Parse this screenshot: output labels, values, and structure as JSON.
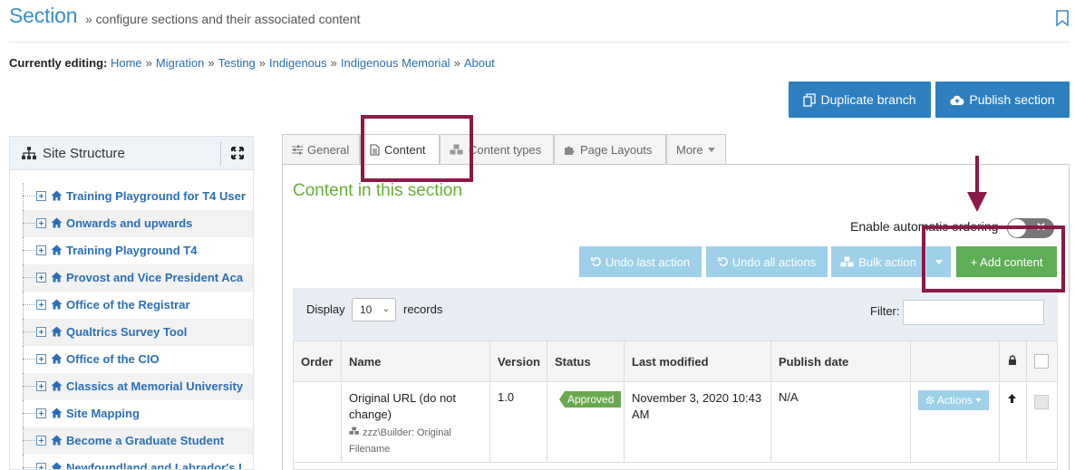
{
  "header": {
    "title": "Section",
    "subtitle": "» configure sections and their associated content"
  },
  "breadcrumb": {
    "label": "Currently editing:",
    "items": [
      "Home",
      "Migration",
      "Testing",
      "Indigenous",
      "Indigenous Memorial",
      "About"
    ],
    "separator": "»"
  },
  "actions": {
    "duplicate": "Duplicate branch",
    "publish": "Publish section"
  },
  "site_structure": {
    "title": "Site Structure",
    "items": [
      "Training Playground for T4 User",
      "Onwards and upwards",
      "Training Playground T4",
      "Provost and Vice President Aca",
      "Office of the Registrar",
      "Qualtrics Survey Tool",
      "Office of the CIO",
      "Classics at Memorial University",
      "Site Mapping",
      "Become a Graduate Student",
      "Newfoundland and Labrador's I"
    ]
  },
  "tabs": [
    {
      "label": "General",
      "icon": "sliders-icon",
      "active": false
    },
    {
      "label": "Content",
      "icon": "document-icon",
      "active": true
    },
    {
      "label": "Content types",
      "icon": "cubes-icon",
      "active": false
    },
    {
      "label": "Page Layouts",
      "icon": "puzzle-icon",
      "active": false
    },
    {
      "label": "More",
      "icon": "caret-down-icon",
      "active": false
    }
  ],
  "content": {
    "heading": "Content in this section",
    "auto_ordering_label": "Enable automatic ordering",
    "auto_ordering_toggle": "✕",
    "undo_last": "Undo last action",
    "undo_all": "Undo all actions",
    "bulk_action": "Bulk action",
    "add_content": "+ Add content",
    "display_label": "Display",
    "display_value": "10",
    "records_label": "records",
    "filter_label": "Filter:"
  },
  "table": {
    "columns": [
      "Order",
      "Name",
      "Version",
      "Status",
      "Last modified",
      "Publish date"
    ],
    "rows": [
      {
        "name": "Original URL (do not change)",
        "type": "zzz\\Builder: Original Filename",
        "version": "1.0",
        "status": "Approved",
        "last_modified": "November 3, 2020 10:43 AM",
        "publish_date": "N/A",
        "actions_label": "Actions"
      }
    ]
  },
  "colors": {
    "primary": "#2e7fc0",
    "light_button": "#9fd0e9",
    "success": "#5fad56",
    "heading_green": "#6aae3a",
    "highlight": "#8b1a48",
    "link": "#2a6fb5"
  }
}
